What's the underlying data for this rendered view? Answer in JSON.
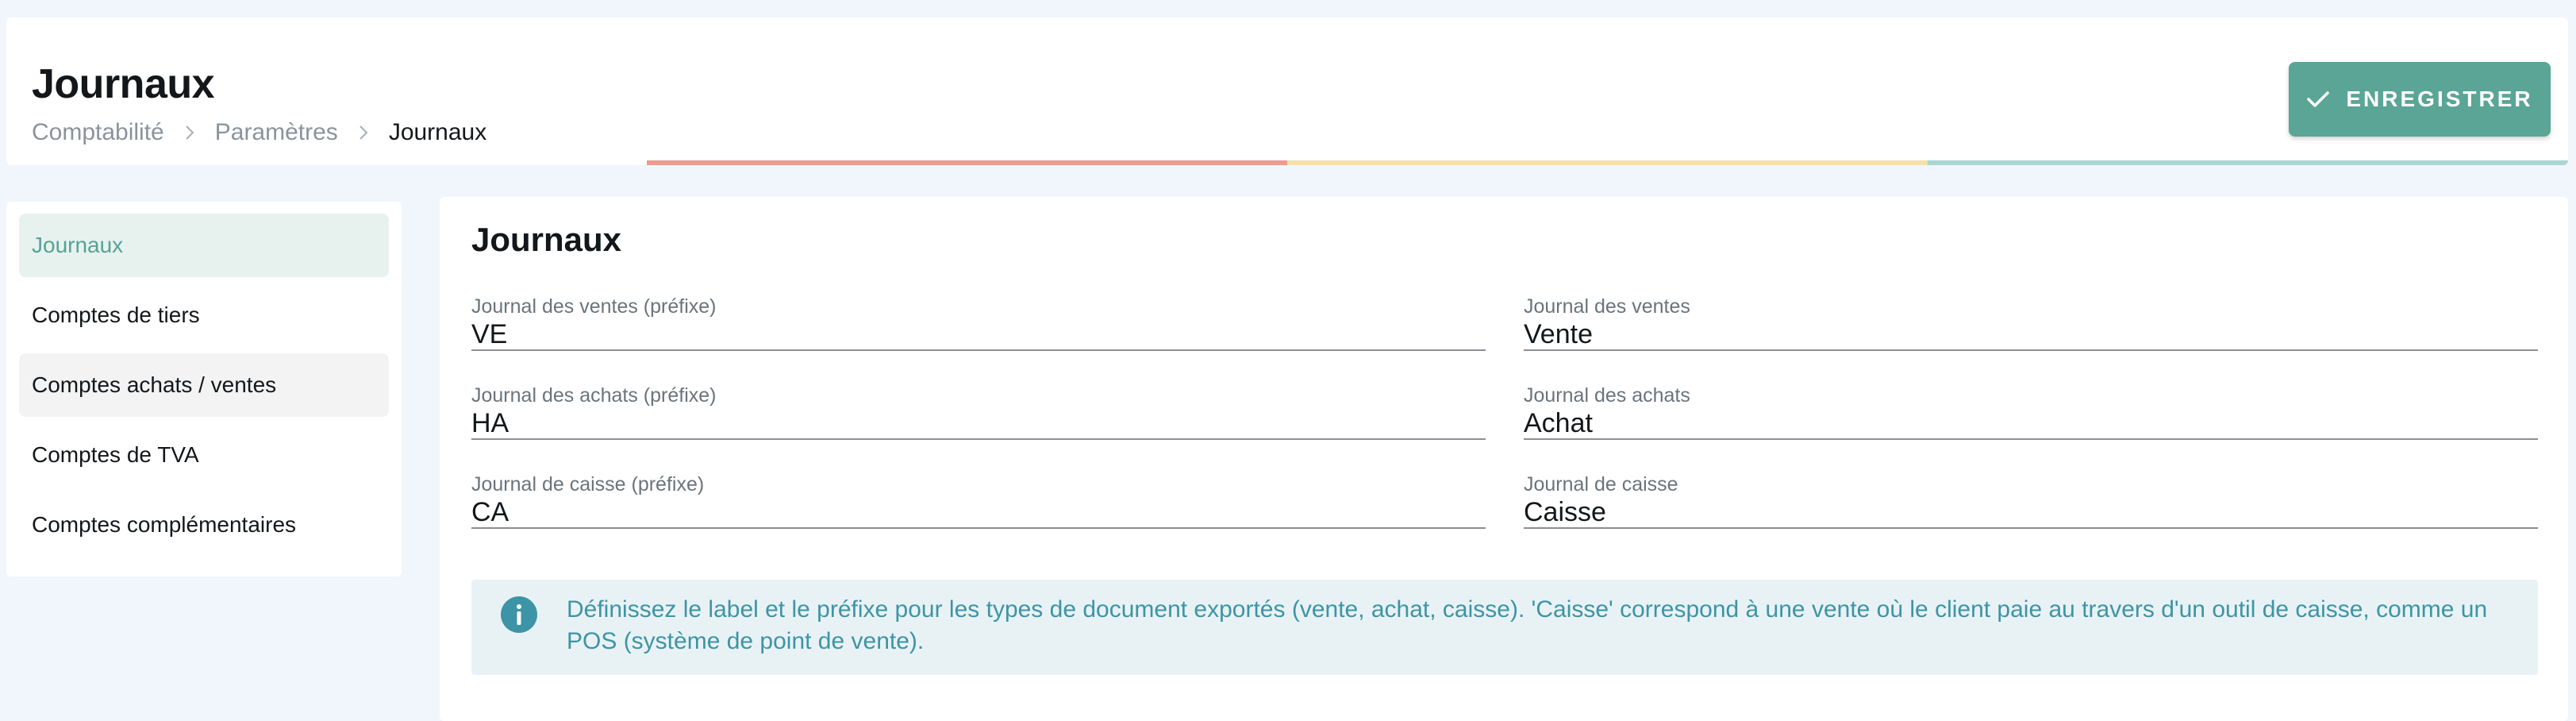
{
  "header": {
    "title": "Journaux",
    "breadcrumb": [
      "Comptabilité",
      "Paramètres",
      "Journaux"
    ],
    "save_label": "ENREGISTRER",
    "save_icon": "check-icon",
    "color_bar": [
      "#ef9a8e",
      "#f5e0a8",
      "#a9d6d3"
    ]
  },
  "colors": {
    "accent": "#5aa596",
    "active_bg": "#e7f2ef",
    "info_text": "#3d94a6",
    "info_bg": "#e8f2f4"
  },
  "sidebar": {
    "items": [
      {
        "label": "Journaux",
        "active": true
      },
      {
        "label": "Comptes de tiers"
      },
      {
        "label": "Comptes achats / ventes",
        "hovered": true
      },
      {
        "label": "Comptes de TVA"
      },
      {
        "label": "Comptes complémentaires"
      }
    ]
  },
  "main": {
    "title": "Journaux",
    "fields": [
      {
        "label": "Journal des ventes (préfixe)",
        "value": "VE"
      },
      {
        "label": "Journal des ventes",
        "value": "Vente"
      },
      {
        "label": "Journal des achats (préfixe)",
        "value": "HA"
      },
      {
        "label": "Journal des achats",
        "value": "Achat"
      },
      {
        "label": "Journal de caisse (préfixe)",
        "value": "CA"
      },
      {
        "label": "Journal de caisse",
        "value": "Caisse"
      }
    ],
    "info": {
      "icon": "info-icon",
      "text": "Définissez le label et le préfixe pour les types de document exportés (vente, achat, caisse). 'Caisse' correspond à une vente où le client paie au travers d'un outil de caisse, comme un POS (système de point de vente)."
    }
  }
}
